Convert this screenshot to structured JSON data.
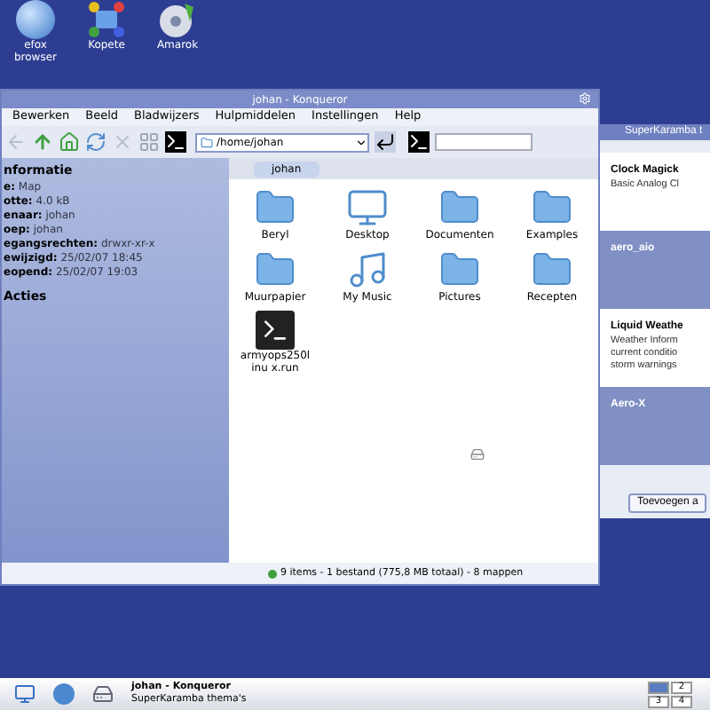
{
  "desktop_icons": [
    {
      "kind": "globe",
      "lines": [
        "efox",
        "browser"
      ]
    },
    {
      "kind": "network",
      "lines": [
        "Kopete"
      ]
    },
    {
      "kind": "disc",
      "lines": [
        "Amarok"
      ]
    }
  ],
  "konqueror": {
    "title": "johan - Konqueror",
    "menu": [
      "Bewerken",
      "Beeld",
      "Bladwijzers",
      "Hulpmiddelen",
      "Instellingen",
      "Help"
    ],
    "location": "/home/johan",
    "breadcrumb": "johan",
    "info_title": "nformatie",
    "info": [
      {
        "label": "e:",
        "value": "Map"
      },
      {
        "label": "otte:",
        "value": "4.0 kB"
      },
      {
        "label": "enaar:",
        "value": "johan"
      },
      {
        "label": "oep:",
        "value": "johan"
      },
      {
        "label": "egangsrechten:",
        "value": "drwxr-xr-x"
      },
      {
        "label": "ewijzigd:",
        "value": "25/02/07 18:45"
      },
      {
        "label": "eopend:",
        "value": "25/02/07 19:03"
      }
    ],
    "actions_title": "Acties",
    "files": [
      {
        "name": "Beryl",
        "kind": "folder"
      },
      {
        "name": "Desktop",
        "kind": "desktop"
      },
      {
        "name": "Documenten",
        "kind": "folder"
      },
      {
        "name": "Examples",
        "kind": "folder"
      },
      {
        "name": "Muurpapier",
        "kind": "folder"
      },
      {
        "name": "My Music",
        "kind": "music"
      },
      {
        "name": "Pictures",
        "kind": "folder"
      },
      {
        "name": "Recepten",
        "kind": "folder"
      },
      {
        "name": "armyops250linu x.run",
        "kind": "terminal"
      }
    ],
    "status": "9 items - 1 bestand (775,8 MB totaal) - 8 mappen"
  },
  "superkaramba": {
    "title": "SuperKaramba t",
    "themes": [
      {
        "name": "Clock Magick",
        "description": [
          "Basic Analog Cl"
        ],
        "selected": false
      },
      {
        "name": "aero_aio",
        "selected": true
      },
      {
        "name": "Liquid Weathe",
        "description": [
          "Weather Inform",
          "current conditio",
          "storm warnings"
        ],
        "selected": false
      },
      {
        "name": "Aero-X",
        "selected": true
      }
    ],
    "button": "Toevoegen a"
  },
  "taskbar": {
    "tasks": [
      {
        "label": "johan - Konqueror",
        "selected": true
      },
      {
        "label": "SuperKaramba thema's",
        "selected": false
      }
    ],
    "pager": [
      {
        "selected": true
      },
      {
        "label": "2",
        "selected": false
      },
      {
        "label": "3",
        "selected": false
      },
      {
        "label": "4",
        "selected": false
      }
    ]
  }
}
